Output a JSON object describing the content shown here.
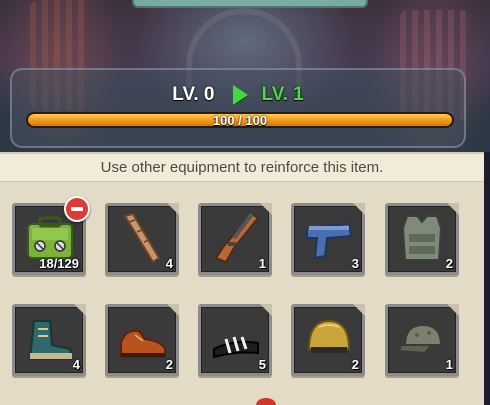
{
  "level": {
    "from_label": "LV. 0",
    "to_label": "LV. 1",
    "progress_text": "100 / 100",
    "progress_fraction": 1.0,
    "arrow_icon": "play-arrow-icon"
  },
  "hint": "Use other equipment to reinforce this item.",
  "items": [
    {
      "name": "supply-case-icon",
      "count": "18/129"
    },
    {
      "name": "wooden-club-icon",
      "count": "4"
    },
    {
      "name": "hunting-rifle-icon",
      "count": "1"
    },
    {
      "name": "pistol-icon",
      "count": "3"
    },
    {
      "name": "body-armor-vest-icon",
      "count": "2"
    },
    {
      "name": "hiking-boot-icon",
      "count": "4"
    },
    {
      "name": "brown-shoe-icon",
      "count": "2"
    },
    {
      "name": "sandal-icon",
      "count": "5"
    },
    {
      "name": "helmet-icon",
      "count": "2"
    },
    {
      "name": "cap-icon",
      "count": "1"
    }
  ],
  "colors": {
    "level_to": "#49dc3e",
    "progress_fill": "#f59a1c",
    "remove_badge": "#e03a36",
    "panel_bg": "#e3dbc6"
  }
}
